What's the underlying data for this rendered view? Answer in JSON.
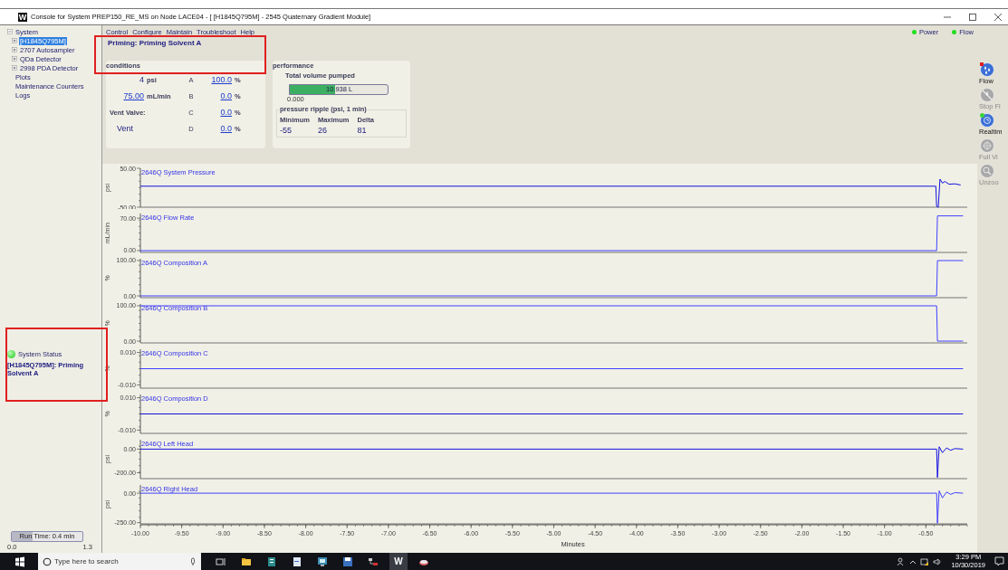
{
  "window": {
    "icon_text": "W",
    "title": "Console for System PREP150_RE_MS on Node LACE04 - [ [H1845Q795M] - 2545 Quaternary Gradient Module]"
  },
  "tree": [
    {
      "label": "System",
      "selected": false,
      "expanded": true,
      "children": [
        {
          "label": "[H1845Q795M]",
          "selected": true,
          "expanded": false
        },
        {
          "label": "2707 Autosampler",
          "selected": false,
          "expanded": false
        },
        {
          "label": "QDa Detector",
          "selected": false,
          "expanded": false
        },
        {
          "label": "2998 PDA Detector",
          "selected": false,
          "expanded": false
        }
      ]
    },
    {
      "label": "Plots",
      "selected": false
    },
    {
      "label": "Maintenance Counters",
      "selected": false
    },
    {
      "label": "Logs",
      "selected": false
    }
  ],
  "system_status": {
    "label": "System Status",
    "ok": true,
    "message": "[H1845Q795M]: Priming Solvent A"
  },
  "run_time": {
    "label": "Run Time: 0.4 min",
    "level": 0.3,
    "min": "0.0",
    "max": "1.3"
  },
  "menu": [
    "Control",
    "Configure",
    "Maintain",
    "Troubleshoot",
    "Help"
  ],
  "heading": "Priming: Priming Solvent A",
  "indicators": [
    {
      "label": "Power",
      "on": true
    },
    {
      "label": "Flow",
      "on": true
    }
  ],
  "conditions": {
    "title": "conditions",
    "readings": [
      {
        "value": "4",
        "unit": "psi",
        "editable": false
      },
      {
        "value": "75.00",
        "unit": "mL/min",
        "editable": true
      }
    ],
    "vent_label": "Vent Valve:",
    "vent_value": "Vent",
    "solvents": [
      {
        "letter": "A",
        "value": "100.0",
        "unit": "%"
      },
      {
        "letter": "B",
        "value": "0.0",
        "unit": "%"
      },
      {
        "letter": "C",
        "value": "0.0",
        "unit": "%"
      },
      {
        "letter": "D",
        "value": "0.0",
        "unit": "%"
      }
    ]
  },
  "performance": {
    "title": "performance",
    "volume_label": "Total volume pumped",
    "volume": {
      "value": "10.938 L",
      "level": 0.46,
      "min": "0.000"
    },
    "ripple": {
      "title": "pressure ripple (psi, 1 min)",
      "stats": [
        {
          "label": "Minimum",
          "value": "-55"
        },
        {
          "label": "Maximum",
          "value": "26"
        },
        {
          "label": "Delta",
          "value": "81"
        }
      ]
    }
  },
  "plots": [
    {
      "chart_data": {
        "type": "line",
        "title": "2646Q System Pressure",
        "ylabel": "psi",
        "xlim": [
          -10,
          0
        ],
        "ylim": [
          -50,
          50
        ],
        "yticks": [
          {
            "value": 50,
            "label": "50.00"
          },
          {
            "value": -50,
            "label": "-50.00"
          }
        ],
        "x": [
          -10,
          -0.38,
          -0.37,
          -0.35,
          -0.33,
          -0.3,
          -0.27,
          -0.22,
          -0.15,
          -0.08
        ],
        "series": [
          {
            "color": "#1010e0",
            "values": [
              4,
              4,
              -48,
              -50,
              22,
              12,
              16,
              9,
              10,
              7
            ]
          }
        ]
      }
    },
    {
      "chart_data": {
        "type": "line",
        "title": "2646Q Flow Rate",
        "ylabel": "mL/min",
        "xlim": [
          -10,
          0
        ],
        "ylim": [
          -4,
          80
        ],
        "yticks": [
          {
            "value": 70,
            "label": "70.00"
          },
          {
            "value": 0,
            "label": "0.00"
          }
        ],
        "x": [
          -10,
          -0.37,
          -0.36,
          -0.05
        ],
        "series": [
          {
            "color": "#4040ff",
            "values": [
              0,
              0,
              75,
              75
            ]
          }
        ]
      }
    },
    {
      "chart_data": {
        "type": "line",
        "title": "2646Q Composition A",
        "ylabel": "%",
        "xlim": [
          -10,
          0
        ],
        "ylim": [
          -5,
          105
        ],
        "yticks": [
          {
            "value": 100,
            "label": "100.00"
          },
          {
            "value": 0,
            "label": "0.00"
          }
        ],
        "x": [
          -10,
          -0.37,
          -0.36,
          -0.05
        ],
        "series": [
          {
            "color": "#4040ff",
            "values": [
              0,
              0,
              100,
              100
            ]
          }
        ]
      }
    },
    {
      "chart_data": {
        "type": "line",
        "title": "2646Q Composition B",
        "ylabel": "%",
        "xlim": [
          -10,
          0
        ],
        "ylim": [
          -5,
          105
        ],
        "yticks": [
          {
            "value": 100,
            "label": "100.00"
          },
          {
            "value": 0,
            "label": "0.00"
          }
        ],
        "x": [
          -10,
          -0.37,
          -0.36,
          -0.05
        ],
        "series": [
          {
            "color": "#4040ff",
            "values": [
              100,
              100,
              0,
              0
            ]
          }
        ]
      }
    },
    {
      "chart_data": {
        "type": "line",
        "title": "2646Q Composition C",
        "ylabel": "%",
        "xlim": [
          -10,
          0
        ],
        "ylim": [
          -0.012,
          0.012
        ],
        "yticks": [
          {
            "value": 0.01,
            "label": "0.010"
          },
          {
            "value": -0.01,
            "label": "-0.010"
          }
        ],
        "x": [
          -10,
          -0.05
        ],
        "series": [
          {
            "color": "#4040ff",
            "values": [
              0,
              0
            ]
          }
        ]
      }
    },
    {
      "chart_data": {
        "type": "line",
        "title": "2646Q Composition D",
        "ylabel": "%",
        "xlim": [
          -10,
          0
        ],
        "ylim": [
          -0.012,
          0.012
        ],
        "yticks": [
          {
            "value": 0.01,
            "label": "0.010"
          },
          {
            "value": -0.01,
            "label": "-0.010"
          }
        ],
        "x": [
          -10,
          -0.05
        ],
        "series": [
          {
            "color": "#1010e0",
            "values": [
              0,
              0
            ]
          }
        ]
      }
    },
    {
      "chart_data": {
        "type": "line",
        "title": "2646Q Left Head",
        "ylabel": "psi",
        "xlim": [
          -10,
          0
        ],
        "ylim": [
          -250,
          80
        ],
        "yticks": [
          {
            "value": 0,
            "label": "0.00"
          },
          {
            "value": -200,
            "label": "-200.00"
          }
        ],
        "x": [
          -10,
          -0.37,
          -0.36,
          -0.34,
          -0.3,
          -0.25,
          -0.2,
          -0.15,
          -0.05
        ],
        "series": [
          {
            "color": "#1010e0",
            "values": [
              0,
              0,
              -240,
              20,
              -30,
              10,
              -10,
              5,
              0
            ]
          }
        ]
      }
    },
    {
      "chart_data": {
        "type": "line",
        "title": "2646Q Right Head",
        "ylabel": "psi",
        "xlabel": "Minutes",
        "xlim": [
          -10,
          0
        ],
        "ylim": [
          -260,
          70
        ],
        "yticks": [
          {
            "value": 0,
            "label": "0.00"
          },
          {
            "value": -250,
            "label": "-250.00"
          }
        ],
        "xticks": [
          {
            "value": -10,
            "label": "-10.00"
          },
          {
            "value": -9.5,
            "label": "-9.50"
          },
          {
            "value": -9,
            "label": "-9.00"
          },
          {
            "value": -8.5,
            "label": "-8.50"
          },
          {
            "value": -8,
            "label": "-8.00"
          },
          {
            "value": -7.5,
            "label": "-7.50"
          },
          {
            "value": -7,
            "label": "-7.00"
          },
          {
            "value": -6.5,
            "label": "-6.50"
          },
          {
            "value": -6,
            "label": "-6.00"
          },
          {
            "value": -5.5,
            "label": "-5.50"
          },
          {
            "value": -5,
            "label": "-5.00"
          },
          {
            "value": -4.5,
            "label": "-4.50"
          },
          {
            "value": -4,
            "label": "-4.00"
          },
          {
            "value": -3.5,
            "label": "-3.50"
          },
          {
            "value": -3,
            "label": "-3.00"
          },
          {
            "value": -2.5,
            "label": "-2.50"
          },
          {
            "value": -2,
            "label": "-2.00"
          },
          {
            "value": -1.5,
            "label": "-1.50"
          },
          {
            "value": -1,
            "label": "-1.00"
          },
          {
            "value": -0.5,
            "label": "-0.50"
          }
        ],
        "x": [
          -10,
          -0.37,
          -0.36,
          -0.34,
          -0.3,
          -0.25,
          -0.2,
          -0.15,
          -0.05
        ],
        "series": [
          {
            "color": "#4040ff",
            "values": [
              0,
              0,
              -255,
              20,
              -40,
              10,
              -10,
              5,
              0
            ]
          }
        ]
      }
    }
  ],
  "toolbar": [
    {
      "kind": "flow",
      "label": "Flow",
      "enabled": true
    },
    {
      "kind": "stop-flow",
      "label": "Stop Fl",
      "enabled": false
    },
    {
      "kind": "realtime",
      "label": "Realtim",
      "enabled": true
    },
    {
      "kind": "full-view",
      "label": "Full Vi",
      "enabled": false
    },
    {
      "kind": "unzoom",
      "label": "Unzoo",
      "enabled": false
    }
  ],
  "taskbar": {
    "search_placeholder": "Type here to search",
    "apps": [
      {
        "kind": "task-view",
        "active": false
      },
      {
        "kind": "folder",
        "active": false
      },
      {
        "kind": "book",
        "active": false
      },
      {
        "kind": "document",
        "active": false
      },
      {
        "kind": "monitor",
        "active": false
      },
      {
        "kind": "disk",
        "active": false
      },
      {
        "kind": "network",
        "active": false
      },
      {
        "kind": "letter",
        "label": "W",
        "active": true
      },
      {
        "kind": "disc",
        "active": false
      }
    ],
    "time": "3:29 PM",
    "date": "10/30/2019"
  }
}
